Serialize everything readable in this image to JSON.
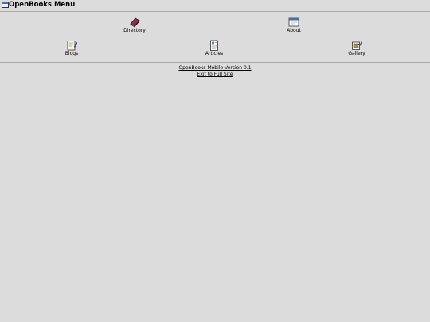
{
  "header": {
    "title": "OpenBooks Menu",
    "logo_icon": "window-icon"
  },
  "menu": {
    "row1": [
      {
        "label": "Directory",
        "icon": "book-icon"
      },
      {
        "label": "About",
        "icon": "window-icon"
      }
    ],
    "row2": [
      {
        "label": "Blogs",
        "icon": "notepad-icon"
      },
      {
        "label": "Articles",
        "icon": "article-icon"
      },
      {
        "label": "Gallery",
        "icon": "picture-icon"
      }
    ]
  },
  "footer": {
    "version": "OpenBooks Mobile Version 0.1",
    "exit": "Exit to Full Site"
  }
}
